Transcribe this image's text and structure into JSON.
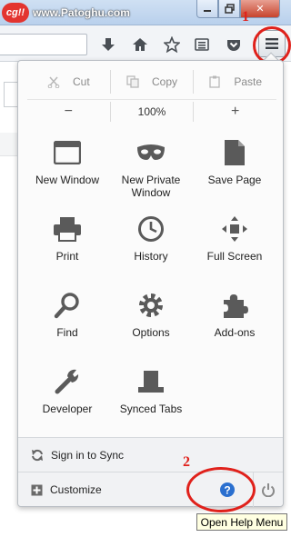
{
  "watermark": {
    "logo": "cg!!",
    "text": "www.Patoghu.com"
  },
  "window_controls": {
    "close": "✕"
  },
  "menu_panel": {
    "edit_row": [
      {
        "label": "Cut",
        "icon": "scissors-icon"
      },
      {
        "label": "Copy",
        "icon": "copy-icon"
      },
      {
        "label": "Paste",
        "icon": "paste-icon"
      }
    ],
    "zoom": {
      "out": "−",
      "level": "100%",
      "in": "+"
    },
    "items": [
      {
        "label": "New Window",
        "icon": "window-icon"
      },
      {
        "label": "New Private Window",
        "icon": "mask-icon"
      },
      {
        "label": "Save Page",
        "icon": "page-icon"
      },
      {
        "label": "Print",
        "icon": "printer-icon"
      },
      {
        "label": "History",
        "icon": "clock-icon"
      },
      {
        "label": "Full Screen",
        "icon": "fullscreen-icon"
      },
      {
        "label": "Find",
        "icon": "magnifier-icon"
      },
      {
        "label": "Options",
        "icon": "gear-icon"
      },
      {
        "label": "Add-ons",
        "icon": "puzzle-icon"
      },
      {
        "label": "Developer",
        "icon": "wrench-icon"
      },
      {
        "label": "Synced Tabs",
        "icon": "synced-tabs-icon"
      }
    ],
    "sync_label": "Sign in to Sync",
    "customize_label": "Customize"
  },
  "tooltip": "Open Help Menu",
  "annotations": {
    "step1": "1",
    "step2": "2",
    "color": "#e0211b"
  },
  "colors": {
    "help_blue": "#2a6fcf",
    "icon_gray": "#5a5a5a"
  }
}
